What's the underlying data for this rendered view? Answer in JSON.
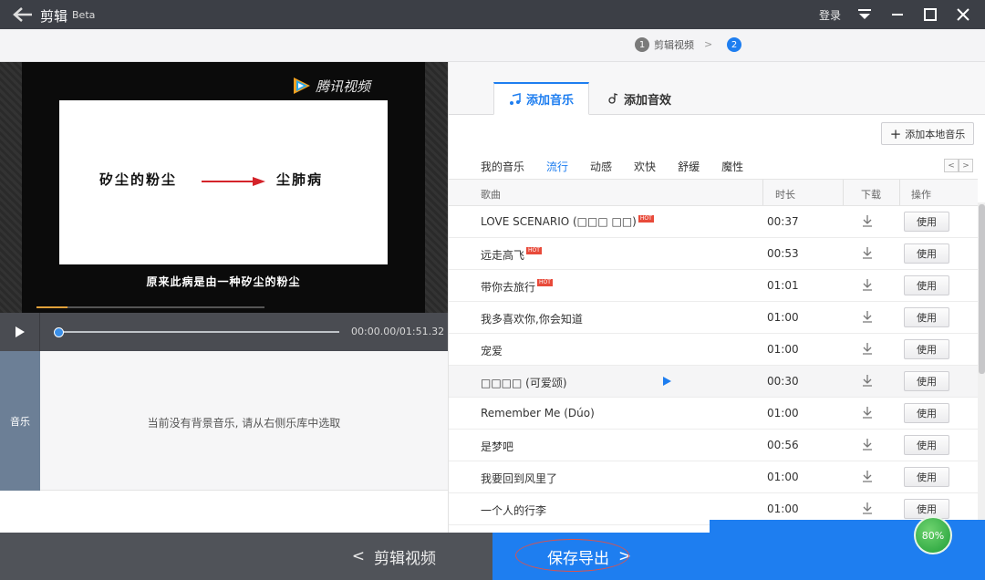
{
  "titlebar": {
    "title": "剪辑",
    "beta": "Beta",
    "login": "登录"
  },
  "steps": [
    {
      "num": "1",
      "label": "剪辑视频"
    },
    {
      "num": "2",
      "label": ""
    }
  ],
  "video": {
    "watermark": "腾讯视频",
    "slide_left": "矽尘的粉尘",
    "slide_right": "尘肺病",
    "subtitle": "原来此病是由一种矽尘的粉尘",
    "time": "00:00.00/01:51.32",
    "progress": 0.0
  },
  "music_track": {
    "label": "音乐",
    "empty_message": "当前没有背景音乐, 请从右侧乐库中选取"
  },
  "right": {
    "tabs": [
      {
        "label": "添加音乐",
        "icon": "music-note-icon",
        "active": true
      },
      {
        "label": "添加音效",
        "icon": "sound-effect-icon",
        "active": false
      }
    ],
    "add_local": "添加本地音乐",
    "categories": [
      {
        "label": "我的音乐",
        "active": false
      },
      {
        "label": "流行",
        "active": true
      },
      {
        "label": "动感",
        "active": false
      },
      {
        "label": "欢快",
        "active": false
      },
      {
        "label": "舒缓",
        "active": false
      },
      {
        "label": "魔性",
        "active": false
      }
    ],
    "pager": {
      "prev": "<",
      "next": ">"
    },
    "columns": [
      "歌曲",
      "时长",
      "下载",
      "操作"
    ],
    "songs": [
      {
        "title": "LOVE SCENARIO (□□□ □□)",
        "hot": true,
        "duration": "00:37",
        "action": "使用"
      },
      {
        "title": "远走高飞",
        "hot": true,
        "duration": "00:53",
        "action": "使用"
      },
      {
        "title": "带你去旅行",
        "hot": true,
        "duration": "01:01",
        "action": "使用"
      },
      {
        "title": "我多喜欢你,你会知道",
        "hot": false,
        "duration": "01:00",
        "action": "使用"
      },
      {
        "title": "宠爱",
        "hot": false,
        "duration": "01:00",
        "action": "使用"
      },
      {
        "title": "□□□□ (可爱颂)",
        "hot": false,
        "duration": "00:30",
        "action": "使用",
        "hover": true
      },
      {
        "title": "Remember Me (Dúo)",
        "hot": false,
        "duration": "01:00",
        "action": "使用"
      },
      {
        "title": "是梦吧",
        "hot": false,
        "duration": "00:56",
        "action": "使用"
      },
      {
        "title": "我要回到风里了",
        "hot": false,
        "duration": "01:00",
        "action": "使用"
      },
      {
        "title": "一个人的行李",
        "hot": false,
        "duration": "01:00",
        "action": "使用"
      }
    ],
    "hot_label": "HOT"
  },
  "bottom": {
    "edit_label": "剪辑视频",
    "save_label": "保存导出",
    "progress_badge": "80%"
  },
  "colors": {
    "accent": "#1e7ef0",
    "titlebar": "#3c3f46",
    "hot": "#e84a3a"
  }
}
